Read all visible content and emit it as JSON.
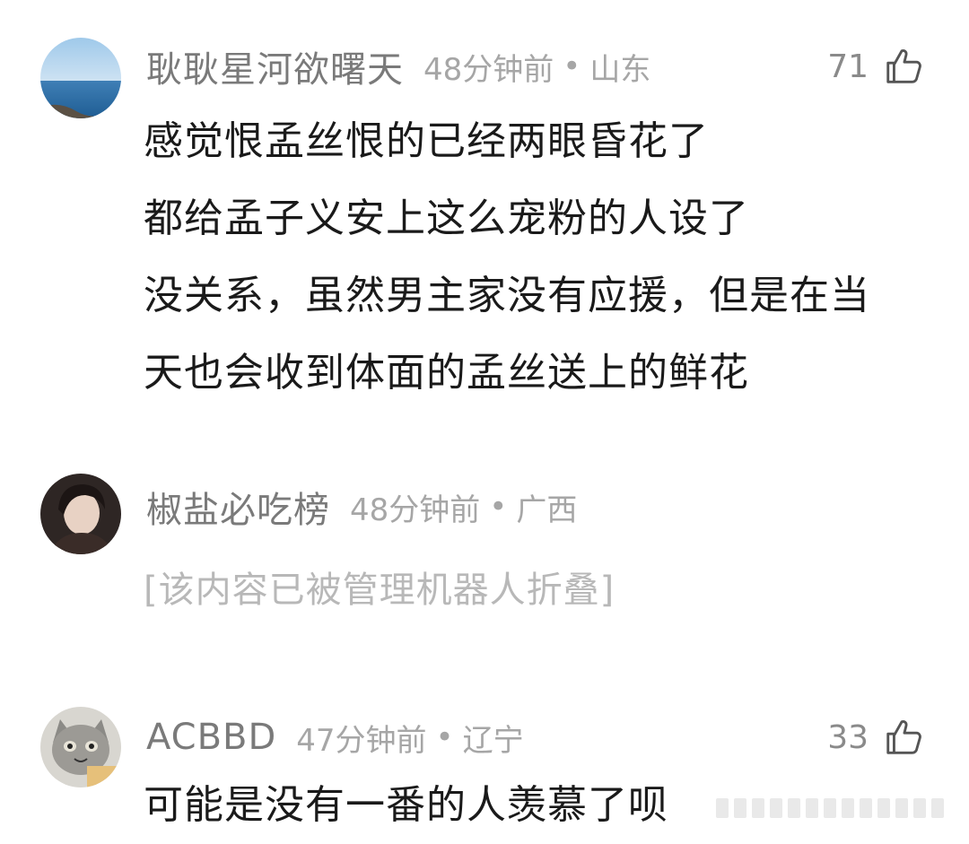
{
  "comments": [
    {
      "username": "耿耿星河欲曙天",
      "time": "48分钟前",
      "separator": "•",
      "region": "山东",
      "likes": "71",
      "avatar_icon": "sea-horizon-avatar",
      "lines": [
        "感觉恨孟丝恨的已经两眼昏花了",
        "都给孟子义安上这么宠粉的人设了",
        "没关系，虽然男主家没有应援，但是在当",
        "天也会收到体面的孟丝送上的鲜花"
      ]
    },
    {
      "username": "椒盐必吃榜",
      "time": "48分钟前",
      "separator": "•",
      "region": "广西",
      "avatar_icon": "person-portrait-avatar",
      "folded_text": "[该内容已被管理机器人折叠]"
    },
    {
      "username": "ACBBD",
      "time": "47分钟前",
      "separator": "•",
      "region": "辽宁",
      "likes": "33",
      "avatar_icon": "cat-avatar",
      "lines": [
        "可能是没有一番的人羡慕了呗"
      ]
    }
  ],
  "colors": {
    "username": "#7a7a7a",
    "meta": "#a6a6a6",
    "body_text": "#1a1a1a",
    "folded_text": "#b8b8b8"
  }
}
